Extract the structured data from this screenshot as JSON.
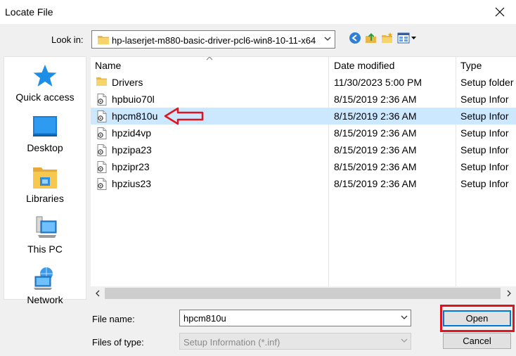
{
  "window": {
    "title": "Locate File"
  },
  "lookin": {
    "label": "Look in:",
    "path": "hp-laserjet-m880-basic-driver-pcl6-win8-10-11-x64"
  },
  "places": [
    {
      "label": "Quick access",
      "icon": "star-icon"
    },
    {
      "label": "Desktop",
      "icon": "desktop-icon"
    },
    {
      "label": "Libraries",
      "icon": "libraries-icon"
    },
    {
      "label": "This PC",
      "icon": "computer-icon"
    },
    {
      "label": "Network",
      "icon": "network-icon"
    }
  ],
  "columns": {
    "name": "Name",
    "date": "Date modified",
    "type": "Type"
  },
  "files": [
    {
      "name": "Drivers",
      "date": "11/30/2023 5:00 PM",
      "type": "Setup folder",
      "kind": "folder"
    },
    {
      "name": "hpbuio70l",
      "date": "8/15/2019 2:36 AM",
      "type": "Setup Infor",
      "kind": "inf"
    },
    {
      "name": "hpcm810u",
      "date": "8/15/2019 2:36 AM",
      "type": "Setup Infor",
      "kind": "inf",
      "selected": true
    },
    {
      "name": "hpzid4vp",
      "date": "8/15/2019 2:36 AM",
      "type": "Setup Infor",
      "kind": "inf"
    },
    {
      "name": "hpzipa23",
      "date": "8/15/2019 2:36 AM",
      "type": "Setup Infor",
      "kind": "inf"
    },
    {
      "name": "hpzipr23",
      "date": "8/15/2019 2:36 AM",
      "type": "Setup Infor",
      "kind": "inf"
    },
    {
      "name": "hpzius23",
      "date": "8/15/2019 2:36 AM",
      "type": "Setup Infor",
      "kind": "inf"
    }
  ],
  "filename": {
    "label": "File name:",
    "value": "hpcm810u"
  },
  "filetype": {
    "label": "Files of type:",
    "value": "Setup Information (*.inf)"
  },
  "buttons": {
    "open": "Open",
    "cancel": "Cancel"
  },
  "colors": {
    "selection": "#cce8ff",
    "annotation": "#e0141e",
    "accent": "#0078d7"
  }
}
